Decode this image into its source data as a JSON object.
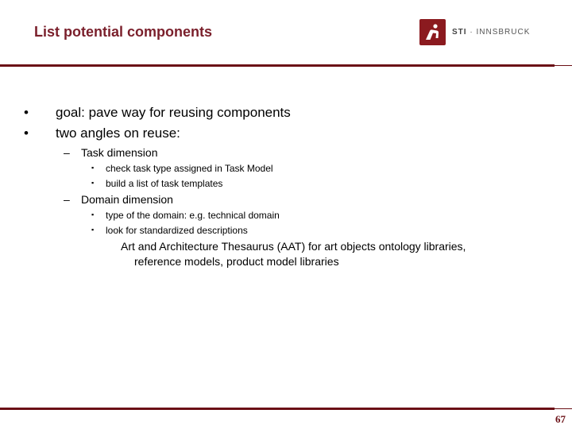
{
  "slide": {
    "title": "List potential components",
    "logo": {
      "brand": "STI",
      "separator": "·",
      "location": "INNSBRUCK"
    },
    "page_number": "67",
    "colors": {
      "accent": "#7a1f2b",
      "rule": "#6b1016",
      "logo_bg": "#8b1a1f"
    }
  },
  "bullets": [
    {
      "marker": "•",
      "text": "goal: pave way for reusing components"
    },
    {
      "marker": "•",
      "text": "two angles on reuse:"
    }
  ],
  "sub": [
    {
      "marker": "–",
      "text": "Task dimension",
      "items": [
        {
          "marker": "▪",
          "text": "check task type assigned in Task Model"
        },
        {
          "marker": "▪",
          "text": "build a list of task templates"
        }
      ]
    },
    {
      "marker": "–",
      "text": "Domain dimension",
      "items": [
        {
          "marker": "▪",
          "text": "type of the domain: e.g. technical domain"
        },
        {
          "marker": "▪",
          "text": "look for  standardized descriptions"
        }
      ]
    }
  ],
  "continuation": {
    "line1": "Art and Architecture Thesaurus (AAT) for art objects ontology libraries,",
    "line2": "reference models, product model libraries"
  }
}
